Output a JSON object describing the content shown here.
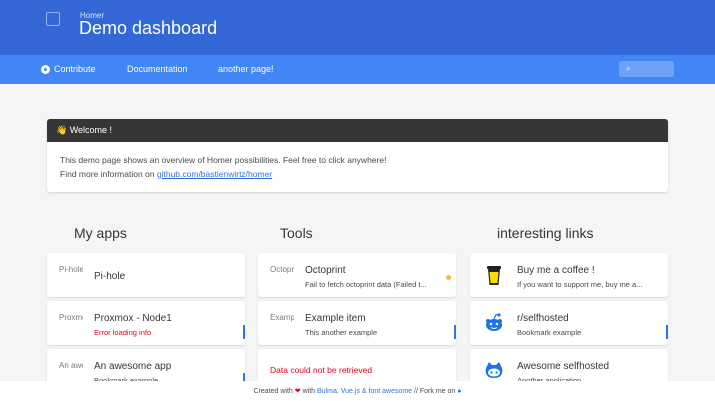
{
  "header": {
    "subtitle": "Homer",
    "title": "Demo dashboard"
  },
  "navbar": {
    "links": [
      {
        "label": "Contribute"
      },
      {
        "label": "Documentation"
      },
      {
        "label": "another page!"
      }
    ],
    "search": {
      "placeholder": ""
    }
  },
  "welcome": {
    "title": "👋 Welcome !",
    "line1": "This demo page shows an overview of Homer possibilities. Feel free to click anywhere!",
    "line2_prefix": "Find more information on ",
    "link": "github.com/bastienwirtz/homer"
  },
  "columns": [
    {
      "title": "My apps",
      "items": [
        {
          "thumb": "Pi-hole",
          "name": "Pi-hole",
          "sub": ""
        },
        {
          "thumb": "Proxmox",
          "name": "Proxmox - Node1",
          "sub": "Error loading info"
        },
        {
          "thumb": "An awesome",
          "name": "An awesome app",
          "sub": "Bookmark example"
        }
      ]
    },
    {
      "title": "Tools",
      "items": [
        {
          "thumb": "Octoprint",
          "name": "Octoprint",
          "sub": "Fail to fetch octoprint data (Failed t..."
        },
        {
          "thumb": "Example",
          "name": "Example item",
          "sub": "This another example"
        },
        {
          "message": "Data could not be retrieved"
        }
      ]
    },
    {
      "title": "interesting links",
      "items": [
        {
          "name": "Buy me a coffee !",
          "sub": "If you want to support me, buy me a..."
        },
        {
          "name": "r/selfhosted",
          "sub": "Bookmark example"
        },
        {
          "name": "Awesome selfhosted",
          "sub": "Another application"
        }
      ]
    }
  ],
  "footer": {
    "created": "Created with",
    "with": "with",
    "stack": "Bulma, Vue.js & font awesome",
    "fork": "// Fork me on"
  },
  "colors": {
    "header": "#3367d6",
    "navbar": "#4285f4",
    "error": "#e3001b"
  }
}
